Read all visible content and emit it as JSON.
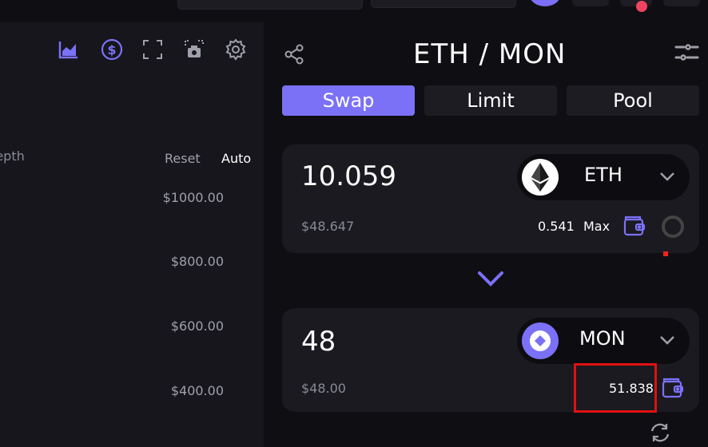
{
  "chart": {
    "depth_label": "Depth",
    "reset_label": "Reset",
    "auto_label": "Auto",
    "price_levels": [
      "$1000.00",
      "$800.00",
      "$600.00",
      "$400.00"
    ],
    "tools": [
      "chart-icon",
      "dollar-icon",
      "fullscreen-icon",
      "screenshot-icon",
      "gear-icon"
    ]
  },
  "swap": {
    "pair_title": "ETH / MON",
    "tabs": [
      {
        "label": "Swap",
        "active": true
      },
      {
        "label": "Limit",
        "active": false
      },
      {
        "label": "Pool",
        "active": false
      }
    ],
    "from": {
      "amount": "10.059",
      "usd_value": "$48.647",
      "token": "ETH",
      "balance": "0.541",
      "max_label": "Max"
    },
    "to": {
      "amount": "48",
      "usd_value": "$48.00",
      "token": "MON",
      "balance": "51.838"
    }
  },
  "colors": {
    "accent": "#7b71f7",
    "panel": "#16161c",
    "card": "#1a1a20",
    "notification": "#f0435f"
  }
}
